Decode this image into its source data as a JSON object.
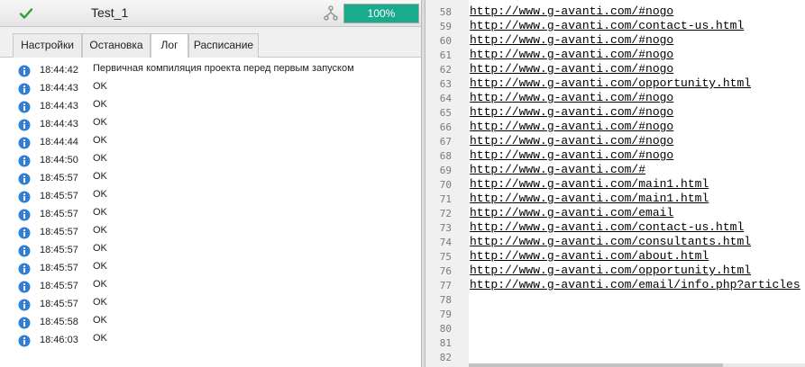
{
  "task": {
    "name": "Test_1",
    "progress_label": "100%",
    "progress": 1.0
  },
  "tabs": [
    {
      "label": "Настройки",
      "active": false
    },
    {
      "label": "Остановка",
      "active": false
    },
    {
      "label": "Лог",
      "active": true
    },
    {
      "label": "Расписание",
      "active": false
    }
  ],
  "log": [
    {
      "time": "18:44:42",
      "msg": "Первичная компиляция проекта перед первым запуском"
    },
    {
      "time": "18:44:43",
      "msg": "OK"
    },
    {
      "time": "18:44:43",
      "msg": "OK"
    },
    {
      "time": "18:44:43",
      "msg": "OK"
    },
    {
      "time": "18:44:44",
      "msg": "OK"
    },
    {
      "time": "18:44:50",
      "msg": "OK"
    },
    {
      "time": "18:45:57",
      "msg": "OK"
    },
    {
      "time": "18:45:57",
      "msg": "OK"
    },
    {
      "time": "18:45:57",
      "msg": "OK"
    },
    {
      "time": "18:45:57",
      "msg": "OK"
    },
    {
      "time": "18:45:57",
      "msg": "OK"
    },
    {
      "time": "18:45:57",
      "msg": "OK"
    },
    {
      "time": "18:45:57",
      "msg": "OK"
    },
    {
      "time": "18:45:57",
      "msg": "OK"
    },
    {
      "time": "18:45:58",
      "msg": "OK"
    },
    {
      "time": "18:46:03",
      "msg": "OK"
    }
  ],
  "editor": {
    "lines": [
      {
        "n": "58",
        "text": "http://www.g-avanti.com/#nogo"
      },
      {
        "n": "59",
        "text": "http://www.g-avanti.com/contact-us.html"
      },
      {
        "n": "60",
        "text": "http://www.g-avanti.com/#nogo"
      },
      {
        "n": "61",
        "text": "http://www.g-avanti.com/#nogo"
      },
      {
        "n": "62",
        "text": "http://www.g-avanti.com/#nogo"
      },
      {
        "n": "63",
        "text": "http://www.g-avanti.com/opportunity.html"
      },
      {
        "n": "64",
        "text": "http://www.g-avanti.com/#nogo"
      },
      {
        "n": "65",
        "text": "http://www.g-avanti.com/#nogo"
      },
      {
        "n": "66",
        "text": "http://www.g-avanti.com/#nogo"
      },
      {
        "n": "67",
        "text": "http://www.g-avanti.com/#nogo"
      },
      {
        "n": "68",
        "text": "http://www.g-avanti.com/#nogo"
      },
      {
        "n": "69",
        "text": "http://www.g-avanti.com/#"
      },
      {
        "n": "70",
        "text": "http://www.g-avanti.com/main1.html"
      },
      {
        "n": "71",
        "text": "http://www.g-avanti.com/main1.html"
      },
      {
        "n": "72",
        "text": "http://www.g-avanti.com/email"
      },
      {
        "n": "73",
        "text": "http://www.g-avanti.com/contact-us.html"
      },
      {
        "n": "74",
        "text": "http://www.g-avanti.com/consultants.html"
      },
      {
        "n": "75",
        "text": "http://www.g-avanti.com/about.html"
      },
      {
        "n": "76",
        "text": "http://www.g-avanti.com/opportunity.html"
      },
      {
        "n": "77",
        "text": "http://www.g-avanti.com/email/info.php?articles"
      },
      {
        "n": "78",
        "text": ""
      },
      {
        "n": "79",
        "text": ""
      },
      {
        "n": "80",
        "text": ""
      },
      {
        "n": "81",
        "text": ""
      },
      {
        "n": "82",
        "text": ""
      }
    ]
  },
  "colors": {
    "progress": "#1aaa8c",
    "info_icon": "#2f7fd8",
    "check": "#2e9e3a"
  }
}
